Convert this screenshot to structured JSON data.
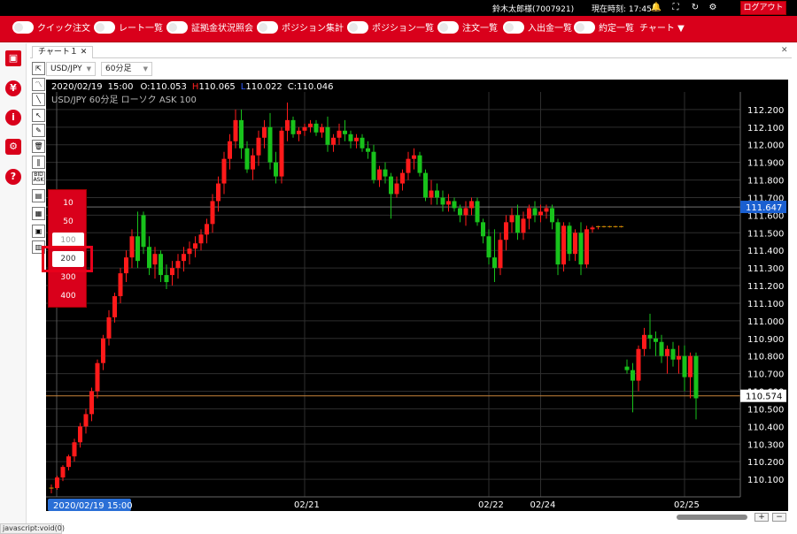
{
  "header": {
    "user": "鈴木太郎様(7007921)",
    "clock_label": "現在時刻:",
    "clock_time": "17:45",
    "logout_label": "ログアウト"
  },
  "menu": {
    "items": [
      "クイック注文",
      "レート一覧",
      "証拠金状況照会",
      "ポジション集計",
      "ポジション一覧",
      "注文一覧",
      "入出金一覧",
      "約定一覧"
    ],
    "chart_menu": "チャート"
  },
  "tab": {
    "title": "チャート１",
    "close": "✕"
  },
  "close_panel": "✕",
  "toolbar": {
    "pair": "USD/JPY",
    "timeframe": "60分足"
  },
  "ohlc": {
    "date": "2020/02/19",
    "time": "15:00",
    "open_label": "O:",
    "open": "110.053",
    "high_label": "H",
    "high": "110.065",
    "low_label": "L",
    "low": "110.022",
    "close_label": "C:",
    "close": "110.046"
  },
  "chart_subtitle": "USD/JPY  60分足  ローソク  ASK  100",
  "period_popup": {
    "options": [
      "10",
      "50",
      "100",
      "200",
      "300",
      "400"
    ],
    "selected": "200"
  },
  "scroll": {
    "plus": "+",
    "minus": "−"
  },
  "status_text": "javascript:void(0)",
  "colors": {
    "brand": "#d9001b",
    "up": "#ff1a1a",
    "down": "#18c21b",
    "current_line": "#ffffff",
    "ref_line": "#c8843a",
    "cursor_date_bg": "#2a6fd6"
  },
  "chart_data": {
    "type": "candlestick",
    "y_axis": {
      "min": 110.0,
      "max": 112.3,
      "ticks": [
        "112.200",
        "112.100",
        "112.000",
        "111.900",
        "111.800",
        "111.700",
        "111.600",
        "111.500",
        "111.400",
        "111.300",
        "111.200",
        "111.100",
        "111.000",
        "110.900",
        "110.800",
        "110.700",
        "110.600",
        "110.500",
        "110.400",
        "110.300",
        "110.200",
        "110.100"
      ]
    },
    "x_axis": {
      "labels": [
        {
          "label": "02/21",
          "index": 44
        },
        {
          "label": "02/22",
          "index": 76
        },
        {
          "label": "02/24",
          "index": 85
        },
        {
          "label": "02/25",
          "index": 110
        }
      ],
      "cursor_label": "2020/02/19 15:00"
    },
    "current_price": {
      "value": 111.647,
      "label": "111.647"
    },
    "ref_price": {
      "value": 110.574,
      "label": "110.574",
      "hidden_label": "110.600"
    },
    "gap_after_index": 117,
    "candles": [
      [
        110.05,
        110.07,
        110.02,
        110.05
      ],
      [
        110.05,
        110.12,
        110.04,
        110.11
      ],
      [
        110.11,
        110.18,
        110.09,
        110.17
      ],
      [
        110.17,
        110.24,
        110.15,
        110.23
      ],
      [
        110.23,
        110.33,
        110.2,
        110.31
      ],
      [
        110.31,
        110.42,
        110.28,
        110.4
      ],
      [
        110.4,
        110.5,
        110.36,
        110.47
      ],
      [
        110.47,
        110.62,
        110.43,
        110.6
      ],
      [
        110.6,
        110.78,
        110.56,
        110.76
      ],
      [
        110.76,
        110.92,
        110.72,
        110.9
      ],
      [
        110.9,
        111.06,
        110.86,
        111.02
      ],
      [
        111.02,
        111.16,
        110.99,
        111.14
      ],
      [
        111.14,
        111.3,
        111.1,
        111.27
      ],
      [
        111.27,
        111.4,
        111.22,
        111.36
      ],
      [
        111.36,
        111.52,
        111.3,
        111.48
      ],
      [
        111.48,
        111.62,
        111.3,
        111.34
      ],
      [
        111.6,
        111.62,
        111.38,
        111.42
      ],
      [
        111.42,
        111.48,
        111.26,
        111.3
      ],
      [
        111.32,
        111.42,
        111.24,
        111.38
      ],
      [
        111.38,
        111.4,
        111.22,
        111.26
      ],
      [
        111.26,
        111.32,
        111.18,
        111.22
      ],
      [
        111.26,
        111.34,
        111.2,
        111.3
      ],
      [
        111.3,
        111.38,
        111.24,
        111.34
      ],
      [
        111.34,
        111.42,
        111.28,
        111.38
      ],
      [
        111.38,
        111.45,
        111.32,
        111.41
      ],
      [
        111.41,
        111.48,
        111.36,
        111.44
      ],
      [
        111.44,
        111.52,
        111.4,
        111.49
      ],
      [
        111.49,
        111.58,
        111.44,
        111.55
      ],
      [
        111.55,
        111.72,
        111.5,
        111.68
      ],
      [
        111.68,
        111.82,
        111.62,
        111.78
      ],
      [
        111.78,
        111.96,
        111.72,
        111.92
      ],
      [
        111.92,
        112.06,
        111.86,
        112.02
      ],
      [
        112.02,
        112.2,
        111.98,
        112.14
      ],
      [
        112.14,
        112.2,
        111.92,
        111.98
      ],
      [
        111.98,
        112.02,
        111.84,
        111.86
      ],
      [
        111.86,
        111.98,
        111.8,
        111.94
      ],
      [
        111.94,
        112.08,
        111.88,
        112.04
      ],
      [
        112.04,
        112.14,
        111.98,
        112.1
      ],
      [
        112.1,
        112.18,
        111.86,
        111.9
      ],
      [
        111.9,
        111.96,
        111.78,
        111.82
      ],
      [
        111.82,
        112.1,
        111.78,
        112.08
      ],
      [
        112.08,
        112.24,
        112.02,
        112.14
      ],
      [
        112.14,
        112.16,
        112.04,
        112.06
      ],
      [
        112.06,
        112.1,
        112.02,
        112.08
      ],
      [
        112.08,
        112.12,
        112.05,
        112.1
      ],
      [
        112.1,
        112.14,
        112.07,
        112.12
      ],
      [
        112.12,
        112.14,
        112.05,
        112.07
      ],
      [
        112.07,
        112.12,
        112.04,
        112.1
      ],
      [
        112.1,
        112.16,
        111.96,
        112.0
      ],
      [
        112.0,
        112.06,
        111.96,
        112.04
      ],
      [
        112.04,
        112.12,
        112.0,
        112.08
      ],
      [
        112.08,
        112.14,
        112.02,
        112.06
      ],
      [
        112.06,
        112.08,
        111.98,
        112.02
      ],
      [
        112.02,
        112.06,
        111.98,
        112.04
      ],
      [
        112.04,
        112.06,
        111.96,
        111.98
      ],
      [
        111.98,
        112.02,
        111.92,
        111.96
      ],
      [
        111.96,
        112.0,
        111.78,
        111.8
      ],
      [
        111.8,
        111.88,
        111.76,
        111.86
      ],
      [
        111.86,
        111.9,
        111.78,
        111.82
      ],
      [
        111.82,
        111.84,
        111.58,
        111.72
      ],
      [
        111.72,
        111.82,
        111.7,
        111.78
      ],
      [
        111.78,
        111.86,
        111.74,
        111.84
      ],
      [
        111.84,
        111.96,
        111.8,
        111.92
      ],
      [
        111.92,
        111.98,
        111.86,
        111.94
      ],
      [
        111.94,
        111.96,
        111.82,
        111.84
      ],
      [
        111.84,
        111.86,
        111.68,
        111.7
      ],
      [
        111.7,
        111.8,
        111.66,
        111.74
      ],
      [
        111.74,
        111.78,
        111.66,
        111.7
      ],
      [
        111.7,
        111.74,
        111.62,
        111.66
      ],
      [
        111.66,
        111.72,
        111.62,
        111.68
      ],
      [
        111.68,
        111.7,
        111.62,
        111.64
      ],
      [
        111.64,
        111.66,
        111.56,
        111.6
      ],
      [
        111.6,
        111.68,
        111.54,
        111.64
      ],
      [
        111.64,
        111.7,
        111.6,
        111.68
      ],
      [
        111.68,
        111.7,
        111.54,
        111.56
      ],
      [
        111.56,
        111.58,
        111.44,
        111.48
      ],
      [
        111.48,
        111.52,
        111.32,
        111.36
      ],
      [
        111.36,
        111.52,
        111.22,
        111.3
      ],
      [
        111.3,
        111.5,
        111.26,
        111.46
      ],
      [
        111.46,
        111.6,
        111.4,
        111.56
      ],
      [
        111.56,
        111.64,
        111.5,
        111.6
      ],
      [
        111.6,
        111.66,
        111.46,
        111.5
      ],
      [
        111.5,
        111.62,
        111.46,
        111.58
      ],
      [
        111.58,
        111.66,
        111.52,
        111.64
      ],
      [
        111.64,
        111.68,
        111.56,
        111.6
      ],
      [
        111.6,
        111.66,
        111.56,
        111.62
      ],
      [
        111.62,
        111.66,
        111.58,
        111.64
      ],
      [
        111.64,
        111.66,
        111.52,
        111.56
      ],
      [
        111.56,
        111.58,
        111.26,
        111.32
      ],
      [
        111.32,
        111.56,
        111.28,
        111.54
      ],
      [
        111.54,
        111.56,
        111.34,
        111.38
      ],
      [
        111.38,
        111.52,
        111.34,
        111.5
      ],
      [
        111.5,
        111.56,
        111.26,
        111.32
      ],
      [
        111.32,
        111.54,
        111.3,
        111.52
      ],
      [
        111.52,
        111.54,
        111.5,
        111.53
      ],
      [
        111.53,
        111.54,
        111.52,
        111.535
      ],
      [
        111.535,
        111.54,
        111.53,
        111.535
      ],
      [
        111.535,
        111.54,
        111.53,
        111.535
      ],
      [
        111.535,
        111.54,
        111.53,
        111.535
      ],
      [
        111.535,
        111.54,
        111.53,
        111.535
      ],
      [
        110.74,
        110.78,
        110.7,
        110.72
      ],
      [
        110.72,
        110.76,
        110.48,
        110.66
      ],
      [
        110.66,
        110.86,
        110.6,
        110.84
      ],
      [
        110.84,
        110.96,
        110.8,
        110.92
      ],
      [
        110.92,
        111.04,
        110.84,
        110.9
      ],
      [
        110.9,
        110.94,
        110.8,
        110.88
      ],
      [
        110.88,
        110.92,
        110.76,
        110.8
      ],
      [
        110.8,
        110.86,
        110.7,
        110.84
      ],
      [
        110.84,
        110.88,
        110.74,
        110.78
      ],
      [
        110.78,
        110.86,
        110.7,
        110.8
      ],
      [
        110.8,
        110.86,
        110.6,
        110.68
      ],
      [
        110.68,
        110.82,
        110.56,
        110.8
      ],
      [
        110.8,
        110.82,
        110.44,
        110.56
      ]
    ]
  }
}
